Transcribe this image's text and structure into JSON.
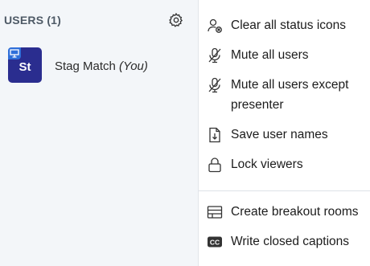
{
  "users_panel": {
    "header": "USERS (1)",
    "settings_icon": "gear-icon",
    "users": [
      {
        "initials": "St",
        "name": "Stag Match",
        "you_suffix": "(You)",
        "presenter_icon": "presenter-screen-icon",
        "avatar_color": "#2a2d8f"
      }
    ]
  },
  "options_menu": {
    "items": [
      {
        "label": "Clear all status icons",
        "icon": "user-clear-status-icon"
      },
      {
        "label": "Mute all users",
        "icon": "microphone-muted-icon"
      },
      {
        "label": "Mute all users except",
        "label_line2": "presenter",
        "icon": "microphone-muted-icon"
      },
      {
        "label": "Save user names",
        "icon": "download-file-icon"
      },
      {
        "label": "Lock viewers",
        "icon": "lock-icon"
      },
      {
        "label": "Create breakout rooms",
        "icon": "breakout-rooms-icon"
      },
      {
        "label": "Write closed captions",
        "icon": "closed-captions-icon"
      }
    ]
  }
}
